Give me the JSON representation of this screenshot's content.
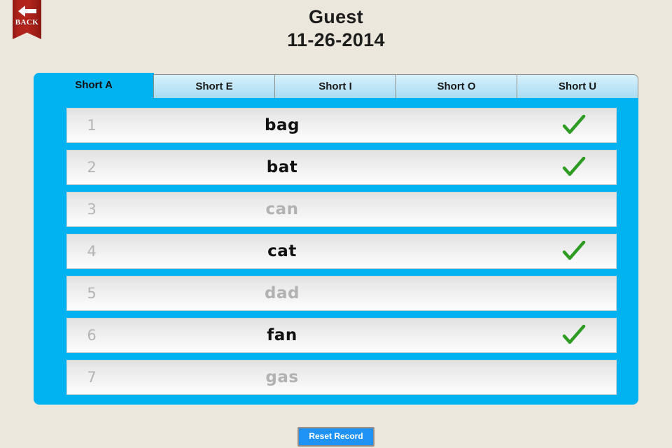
{
  "colors": {
    "page_background": "#ece7dc",
    "panel_blue": "#00b3f0",
    "ribbon_red": "#a8201a",
    "check_green": "#2e9b23",
    "reset_blue": "#1f92f5"
  },
  "back_button": {
    "label": "BACK",
    "icon": "left-arrow-icon"
  },
  "header": {
    "user_name": "Guest",
    "date": "11-26-2014"
  },
  "tabs": [
    {
      "label": "Short A",
      "active": true
    },
    {
      "label": "Short E",
      "active": false
    },
    {
      "label": "Short I",
      "active": false
    },
    {
      "label": "Short O",
      "active": false
    },
    {
      "label": "Short U",
      "active": false
    }
  ],
  "word_list": [
    {
      "number": "1",
      "word": "bag",
      "completed": true
    },
    {
      "number": "2",
      "word": "bat",
      "completed": true
    },
    {
      "number": "3",
      "word": "can",
      "completed": false
    },
    {
      "number": "4",
      "word": "cat",
      "completed": true
    },
    {
      "number": "5",
      "word": "dad",
      "completed": false
    },
    {
      "number": "6",
      "word": "fan",
      "completed": true
    },
    {
      "number": "7",
      "word": "gas",
      "completed": false
    }
  ],
  "footer": {
    "reset_label": "Reset Record"
  }
}
